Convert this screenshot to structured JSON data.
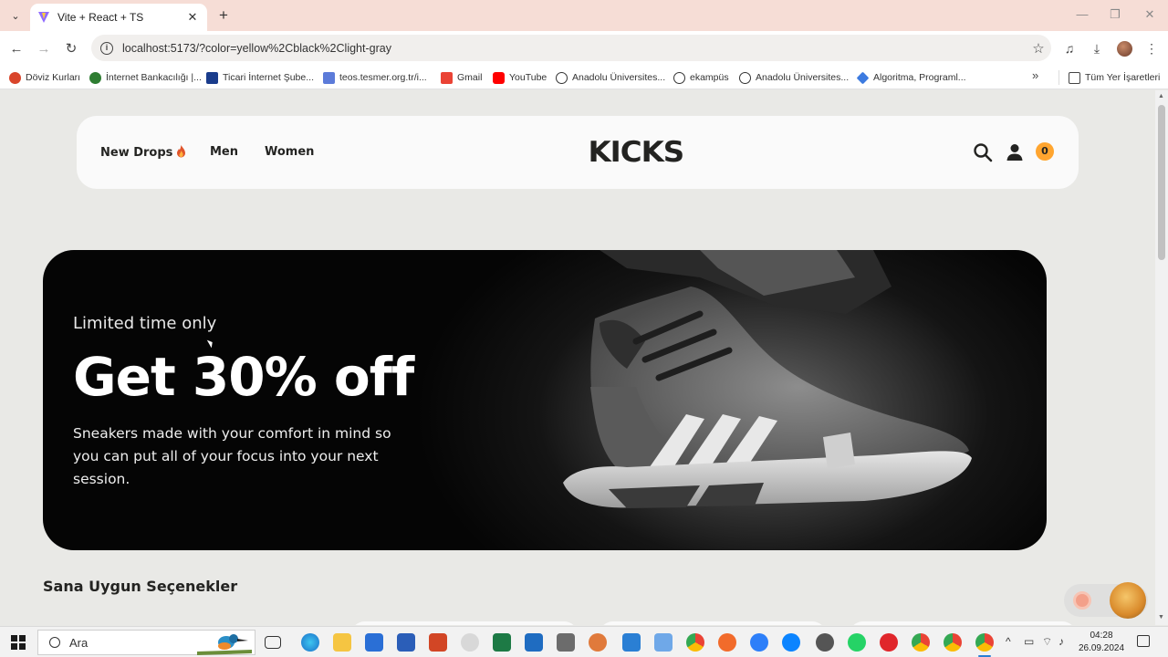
{
  "browser": {
    "tab_title": "Vite + React + TS",
    "url": "localhost:5173/?color=yellow%2Cblack%2Clight-gray",
    "bookmarks": [
      {
        "label": "Döviz Kurları",
        "color": "#d9452b"
      },
      {
        "label": "İnternet Bankacılığı |...",
        "color": "#2e7d32"
      },
      {
        "label": "Ticari İnternet Şube...",
        "color": "#1a3c8c"
      },
      {
        "label": "teos.tesmer.org.tr/i...",
        "color": "#5c7bd9"
      },
      {
        "label": "Gmail",
        "color": "#ea4335"
      },
      {
        "label": "YouTube",
        "color": "#ff0000"
      },
      {
        "label": "Anadolu Üniversites...",
        "color": "#333333"
      },
      {
        "label": "ekampüs",
        "color": "#333333"
      },
      {
        "label": "Anadolu Üniversites...",
        "color": "#333333"
      },
      {
        "label": "Algoritma, Programl...",
        "color": "#3d7be0"
      }
    ],
    "all_bookmarks_label": "Tüm Yer İşaretleri"
  },
  "site": {
    "nav": {
      "new_drops": "New Drops",
      "men": "Men",
      "women": "Women",
      "logo": "KICKS",
      "cart_count": "0"
    },
    "hero": {
      "subtitle": "Limited time only",
      "title": "Get 30% off",
      "text": "Sneakers made with your comfort in mind so you can put all of your focus into your next session."
    },
    "section_title": "Sana Uygun Seçenekler",
    "colors": {
      "accent": "#ffa52f",
      "dark": "#232321",
      "background": "#e9e9e6"
    }
  },
  "taskbar": {
    "search_placeholder": "Ara",
    "time": "04:28",
    "date": "26.09.2024"
  }
}
